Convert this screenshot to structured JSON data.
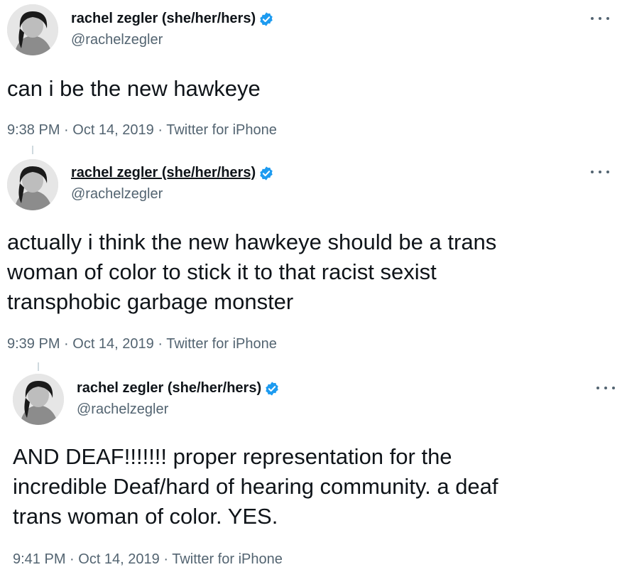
{
  "tweets": [
    {
      "display_name": "rachel zegler (she/her/hers)",
      "handle": "@rachelzegler",
      "text": "can i be the new hawkeye",
      "time": "9:38 PM",
      "date": "Oct 14, 2019",
      "source": "Twitter for iPhone",
      "separator": " · "
    },
    {
      "display_name": "rachel zegler (she/her/hers)",
      "handle": "@rachelzegler",
      "text": "actually i think the new hawkeye should be a trans\nwoman of color to stick it to that racist sexist\ntransphobic garbage monster",
      "time": "9:39 PM",
      "date": "Oct 14, 2019",
      "source": "Twitter for iPhone",
      "separator": " · "
    },
    {
      "display_name": "rachel zegler (she/her/hers)",
      "handle": "@rachelzegler",
      "text": "AND DEAF!!!!!!! proper representation for the\nincredible Deaf/hard of hearing community. a deaf\ntrans woman of color. YES.",
      "time": "9:41 PM",
      "date": "Oct 14, 2019",
      "source": "Twitter for iPhone",
      "separator": " · "
    }
  ],
  "colors": {
    "verified_badge": "#1d9bf0",
    "secondary_text": "#536471",
    "primary_text": "#0f1419",
    "thread_line": "#cfd9de"
  },
  "icons": {
    "verified": "verified-badge-icon",
    "more": "more-options-icon"
  }
}
